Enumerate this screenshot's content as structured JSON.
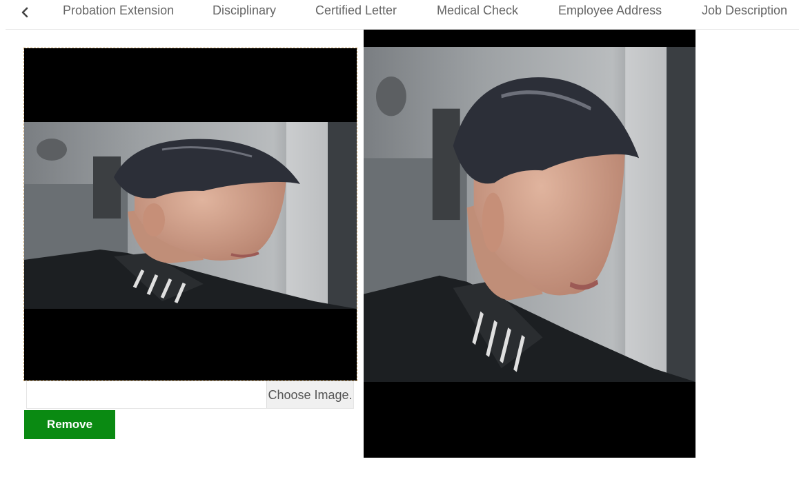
{
  "tabs": [
    {
      "label": "Probation Extension"
    },
    {
      "label": "Disciplinary"
    },
    {
      "label": "Certified Letter"
    },
    {
      "label": "Medical Check"
    },
    {
      "label": "Employee Address"
    },
    {
      "label": "Job Description"
    }
  ],
  "icons": {
    "back": "chevron-left-icon"
  },
  "upload": {
    "choose_label": "Choose Image.",
    "remove_label": "Remove"
  },
  "colors": {
    "remove_button": "#0a8a12",
    "image_background": "#000000"
  }
}
